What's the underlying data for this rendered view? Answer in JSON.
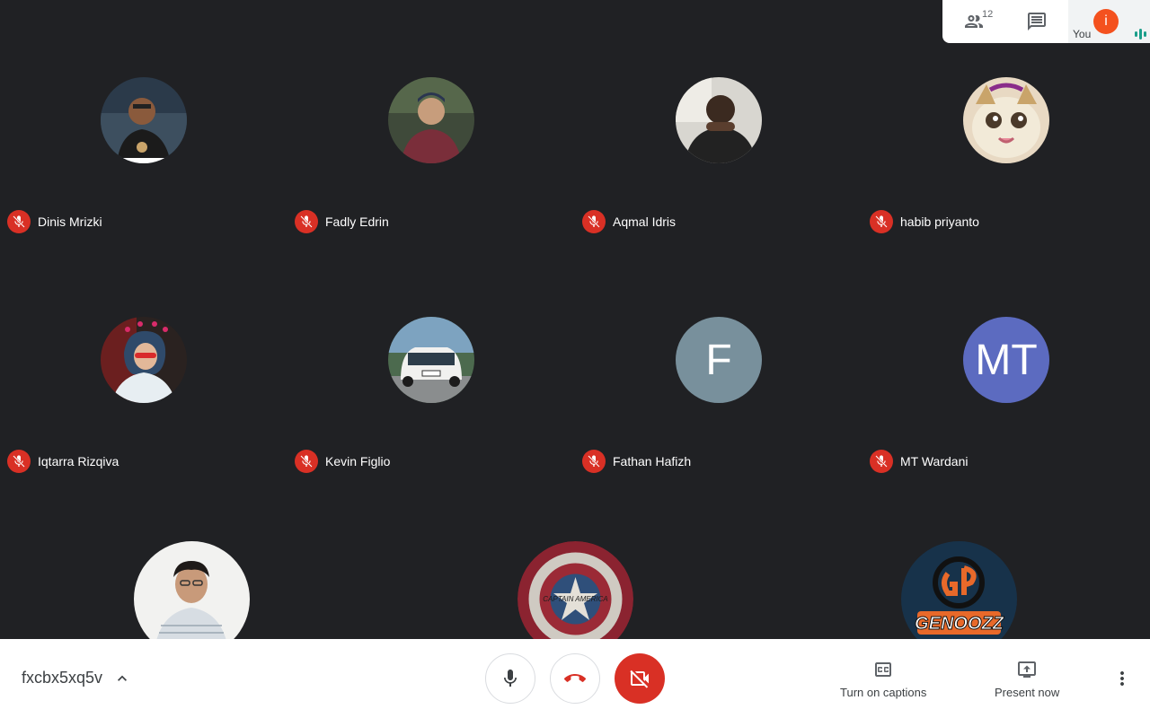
{
  "top_panel": {
    "participants_count": "12",
    "you_label": "You",
    "you_initial": "i"
  },
  "participants": [
    {
      "name": "Dinis Mrizki",
      "avatar": "photo",
      "muted": true
    },
    {
      "name": "Fadly Edrin",
      "avatar": "photo",
      "muted": true
    },
    {
      "name": "Aqmal Idris",
      "avatar": "photo",
      "muted": true
    },
    {
      "name": "habib priyanto",
      "avatar": "photo-cat",
      "muted": true
    },
    {
      "name": "Iqtarra Rizqiva",
      "avatar": "photo",
      "muted": true
    },
    {
      "name": "Kevin Figlio",
      "avatar": "photo-car",
      "muted": true
    },
    {
      "name": "Fathan Hafizh",
      "avatar_initials": "F",
      "avatar_color": "#78909c",
      "muted": true
    },
    {
      "name": "MT Wardani",
      "avatar_initials": "MT",
      "avatar_color": "#5c6bc0",
      "muted": true
    }
  ],
  "bottom_row_avatars": [
    {
      "avatar": "photo"
    },
    {
      "avatar": "captain-america-shield",
      "text": "CAPTAIN AMERICA"
    },
    {
      "avatar": "genoozz-logo",
      "text": "GENOOZZ"
    }
  ],
  "bottom_bar": {
    "meeting_code": "fxcbx5xq5v",
    "captions_label": "Turn on captions",
    "present_label": "Present now"
  },
  "colors": {
    "background": "#202124",
    "mute_red": "#d93025",
    "accent_teal": "#1a9e8a"
  }
}
